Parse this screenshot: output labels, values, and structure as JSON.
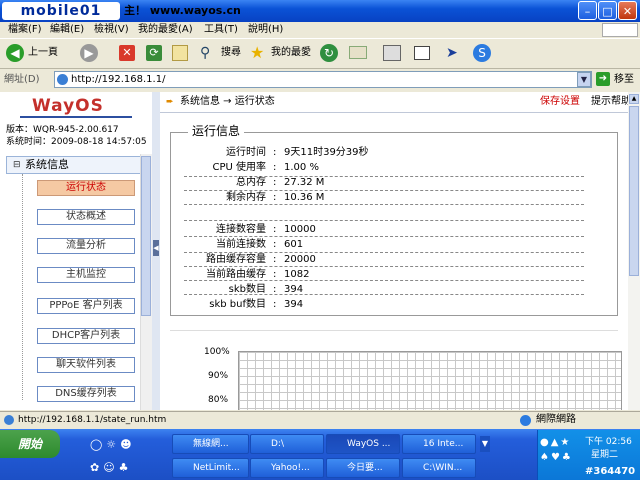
{
  "window": {
    "logo_text": "mobile01",
    "title": "主！ www.wayos.cn"
  },
  "menu": [
    "檔案(F)",
    "編輯(E)",
    "檢視(V)",
    "我的最愛(A)",
    "工具(T)",
    "說明(H)"
  ],
  "toolbar": {
    "back_label": "上一頁",
    "search_label": "搜尋",
    "favorites_label": "我的最愛"
  },
  "address": {
    "label": "網址(D)",
    "url": "http://192.168.1.1/",
    "go_label": "移至"
  },
  "sidebar": {
    "brand": "WayOS",
    "version_line": "版本：WQR-945-2.00.617",
    "time_line": "系统时间：2009-08-18 14:57:05",
    "section": "系统信息",
    "items": [
      "运行状态",
      "状态概述",
      "流量分析",
      "主机监控",
      "PPPoE 客户列表",
      "DHCP客户列表",
      "聊天软件列表",
      "DNS缓存列表"
    ]
  },
  "main": {
    "breadcrumb": "系统信息 → 运行状态",
    "save_label": "保存设置",
    "help_label": "提示帮助",
    "panel_title": "运行信息",
    "rows1": [
      {
        "label": "运行时间",
        "value": "9天11时39分39秒"
      },
      {
        "label": "CPU 使用率",
        "value": "1.00 %"
      },
      {
        "label": "总内存",
        "value": "27.32 M"
      },
      {
        "label": "剩余内存",
        "value": "10.36 M"
      }
    ],
    "rows2": [
      {
        "label": "连接数容量",
        "value": "10000"
      },
      {
        "label": "当前连接数",
        "value": "601"
      },
      {
        "label": "路由缓存容量",
        "value": "20000"
      },
      {
        "label": "当前路由缓存",
        "value": "1082"
      },
      {
        "label": "skb数目",
        "value": "394"
      },
      {
        "label": "skb buf数目",
        "value": "394"
      }
    ],
    "chart_ticks": [
      "100%",
      "90%",
      "80%"
    ]
  },
  "status": {
    "url": "http://192.168.1.1/state_run.htm",
    "zone": "網際網路"
  },
  "taskbar": {
    "start": "開始",
    "row1": [
      "無線網...",
      "D:\\",
      "WayOS ...",
      "16 Inte..."
    ],
    "row2": [
      "NetLimit...",
      "Yahoo!...",
      "今日要...",
      "C:\\WIN..."
    ],
    "time": "下午 02:56",
    "day": "星期二",
    "watermark": "#364470"
  }
}
